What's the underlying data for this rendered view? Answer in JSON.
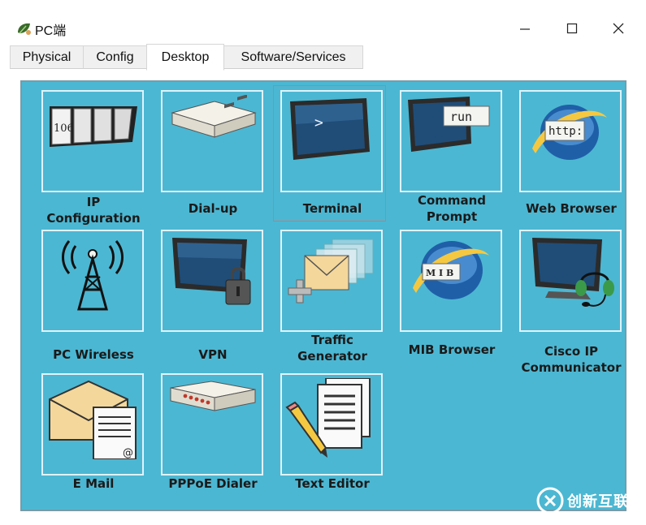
{
  "window": {
    "title": "PC端",
    "controls": [
      "minimize",
      "maximize",
      "close"
    ]
  },
  "tabs": [
    {
      "label": "Physical",
      "active": false
    },
    {
      "label": "Config",
      "active": false
    },
    {
      "label": "Desktop",
      "active": true
    },
    {
      "label": "Software/Services",
      "active": false
    }
  ],
  "desktop": {
    "background_color": "#4cb7d2",
    "selected_app": "Terminal",
    "apps": [
      {
        "label": "IP\nConfiguration",
        "icon": "ip-config-icon",
        "icon_text": "106"
      },
      {
        "label": "Dial-up",
        "icon": "modem-icon"
      },
      {
        "label": "Terminal",
        "icon": "terminal-icon",
        "icon_text": ">"
      },
      {
        "label": "Command\nPrompt",
        "icon": "command-prompt-icon",
        "icon_text": "run"
      },
      {
        "label": "Web Browser",
        "icon": "web-browser-icon",
        "icon_text": "http:"
      },
      {
        "label": "PC Wireless",
        "icon": "wireless-tower-icon"
      },
      {
        "label": "VPN",
        "icon": "vpn-monitor-lock-icon"
      },
      {
        "label": "Traffic\nGenerator",
        "icon": "traffic-envelope-icon"
      },
      {
        "label": "MIB Browser",
        "icon": "mib-browser-icon",
        "icon_text": "M I B"
      },
      {
        "label": "Cisco IP\nCommunicator",
        "icon": "headset-monitor-icon"
      },
      {
        "label": "E Mail",
        "icon": "email-icon",
        "icon_text": "@"
      },
      {
        "label": "PPPoE Dialer",
        "icon": "pppoe-device-icon"
      },
      {
        "label": "Text Editor",
        "icon": "text-editor-icon"
      }
    ]
  },
  "watermark": {
    "text": "创新互联",
    "icon": "watermark-logo-icon"
  }
}
